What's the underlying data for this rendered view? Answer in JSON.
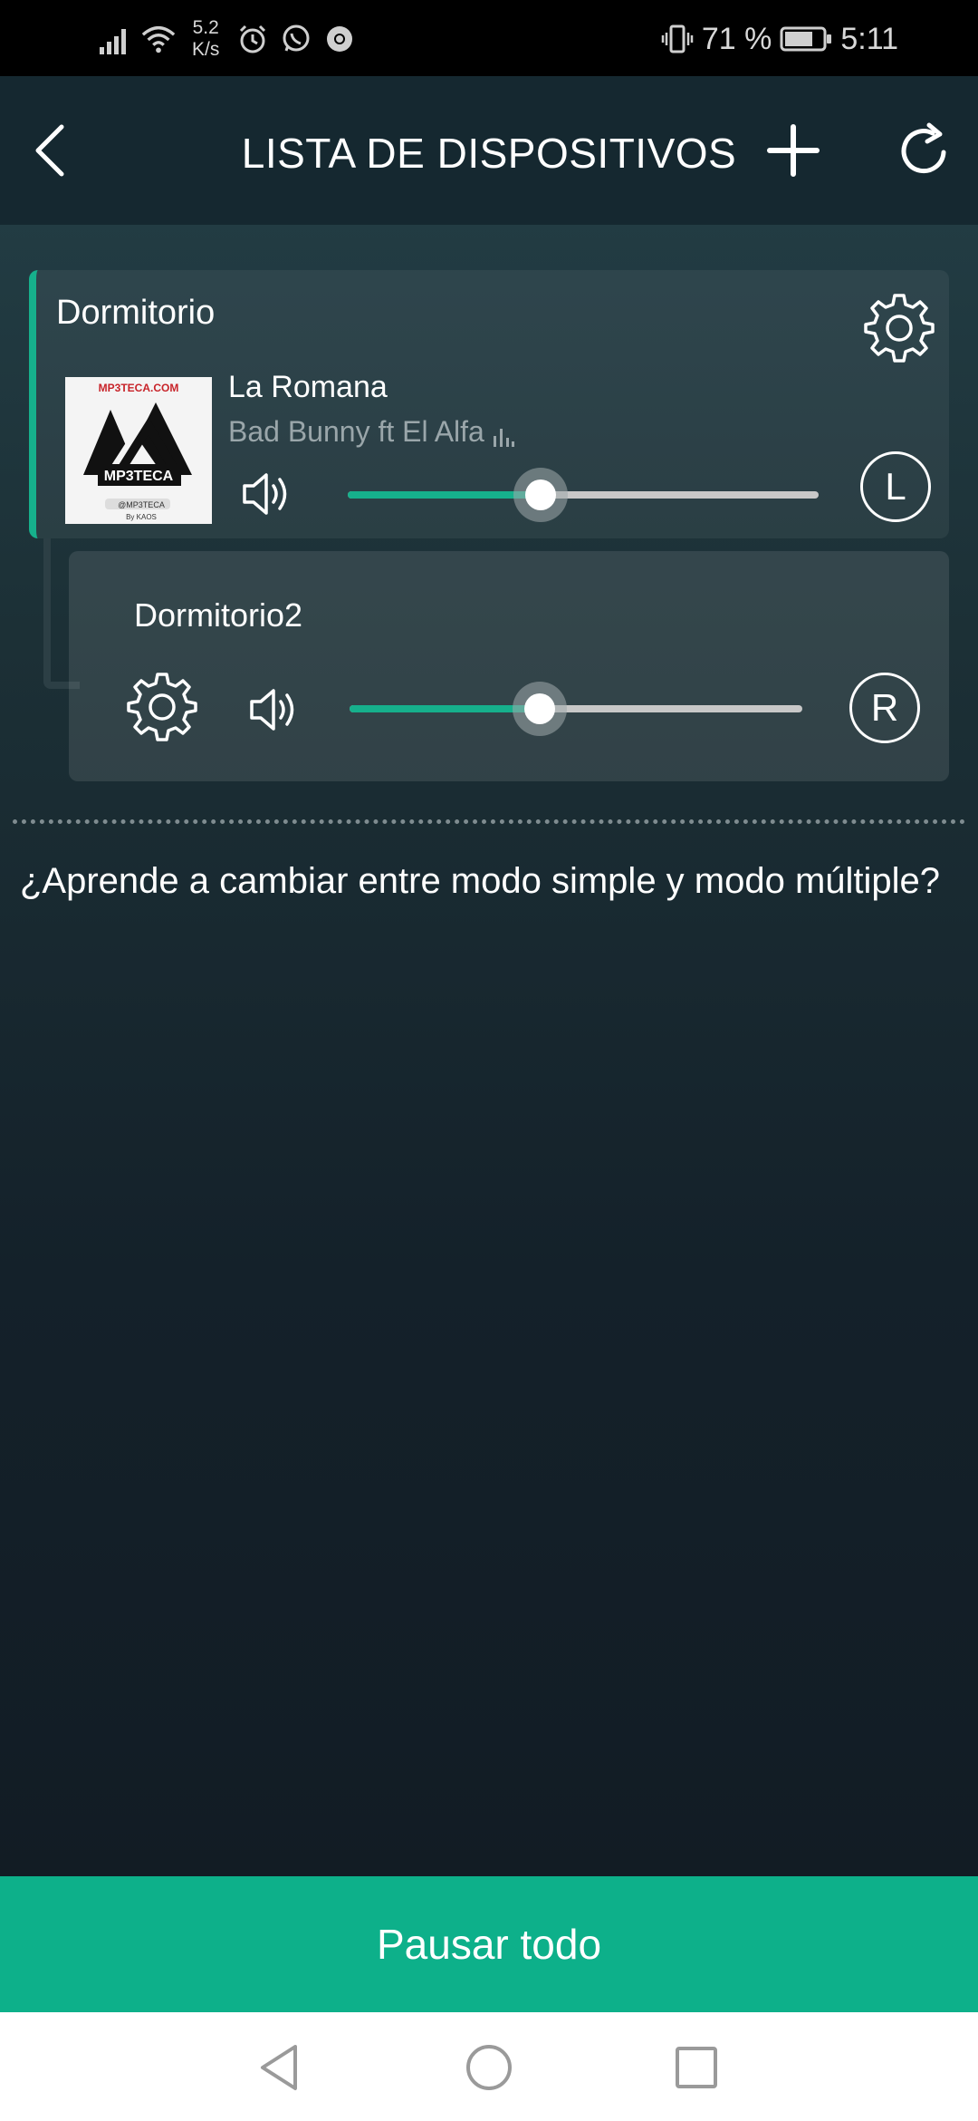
{
  "status_bar": {
    "net_speed_value": "5.2",
    "net_speed_unit": "K/s",
    "battery": "71 %",
    "time": "5:11"
  },
  "header": {
    "title": "LISTA DE DISPOSITIVOS"
  },
  "devices": [
    {
      "name": "Dormitorio",
      "song_title": "La Romana",
      "artist": "Bad Bunny ft El Alfa",
      "album_art": {
        "site": "MP3TECA.COM",
        "brand": "MP3TECA",
        "handle": "@MP3TECA",
        "credit": "By KAOS"
      },
      "volume_percent": 41,
      "channel": "L"
    },
    {
      "name": "Dormitorio2",
      "volume_percent": 42,
      "channel": "R"
    }
  ],
  "help_link": "¿Aprende a cambiar entre modo simple y modo múltiple?",
  "pause_all_label": "Pausar todo",
  "colors": {
    "accent": "#0db08a",
    "header_bg": "#152830",
    "slider_track": "#c8c8c8"
  }
}
